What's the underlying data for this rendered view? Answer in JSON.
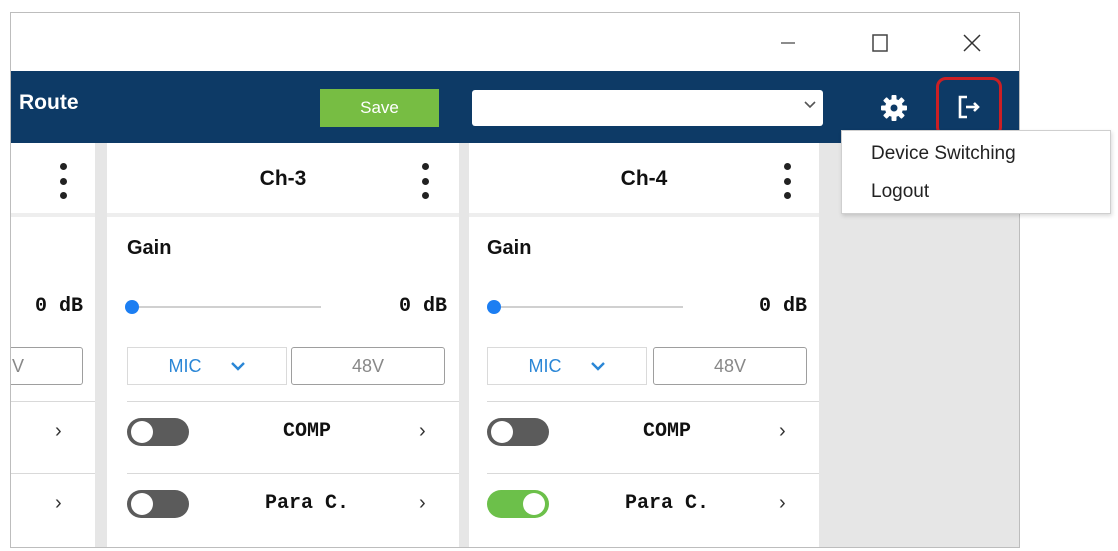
{
  "window": {
    "minimize_icon": "minimize-icon",
    "maximize_icon": "maximize-icon",
    "close_icon": "close-icon"
  },
  "header": {
    "title": "Route",
    "save_label": "Save",
    "device_select_value": "",
    "settings_icon": "gear-icon",
    "logout_icon": "logout-icon",
    "highlight_color": "#cc1f24"
  },
  "menu": {
    "items": [
      {
        "label": "Device Switching"
      },
      {
        "label": "Logout"
      }
    ]
  },
  "channels": [
    {
      "name": "",
      "gain_label": "",
      "gain_value": "0  dB",
      "gain_level": 0,
      "input_type": "",
      "phantom_label": "V",
      "rows": [
        {
          "label": "",
          "enabled": null
        },
        {
          "label": "",
          "enabled": null
        }
      ]
    },
    {
      "name": "Ch-3",
      "gain_label": "Gain",
      "gain_value": "0  dB",
      "gain_level": 0,
      "input_type": "MIC",
      "phantom_label": "48V",
      "rows": [
        {
          "label": "COMP",
          "enabled": false
        },
        {
          "label": "Para C.",
          "enabled": false
        }
      ]
    },
    {
      "name": "Ch-4",
      "gain_label": "Gain",
      "gain_value": "0  dB",
      "gain_level": 0,
      "input_type": "MIC",
      "phantom_label": "48V",
      "rows": [
        {
          "label": "COMP",
          "enabled": false
        },
        {
          "label": "Para C.",
          "enabled": true
        }
      ]
    }
  ],
  "colors": {
    "topbar": "#0d3a66",
    "save_button": "#77bd43",
    "slider_thumb": "#1c7ef2",
    "toggle_on": "#6cc04a",
    "toggle_off": "#5b5b5b",
    "mic_text": "#2a86d6"
  }
}
